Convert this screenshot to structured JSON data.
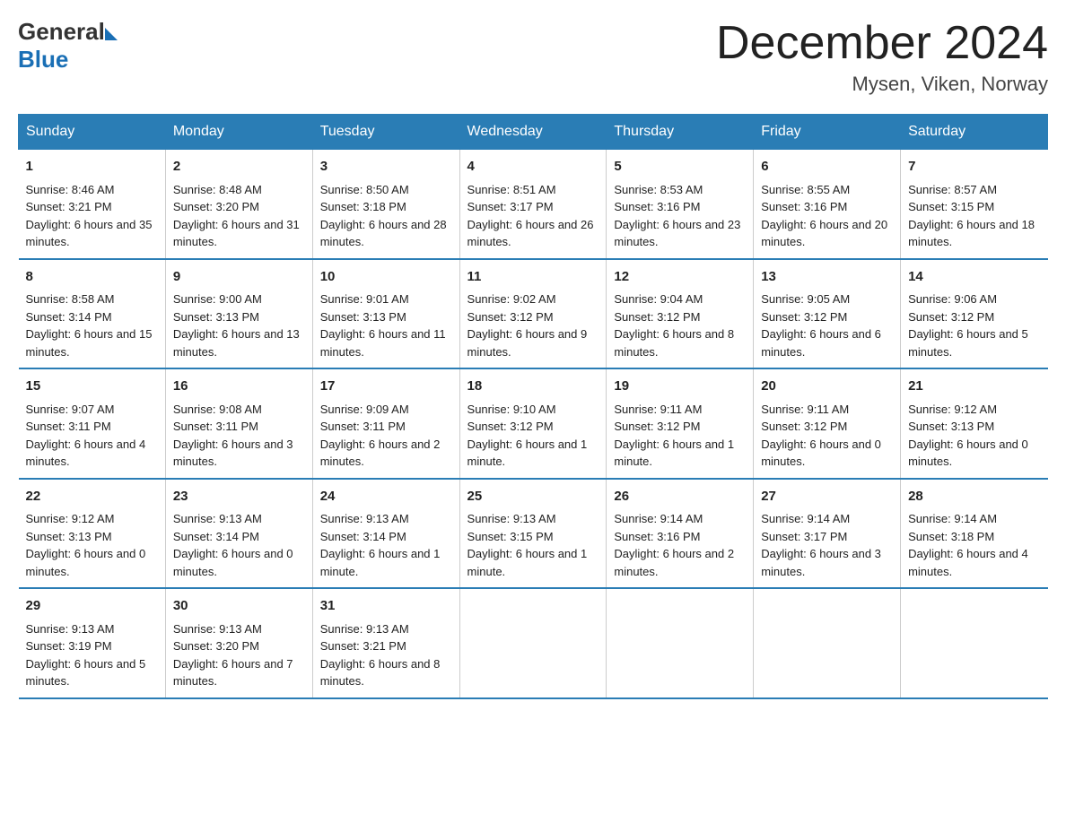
{
  "header": {
    "logo_general": "General",
    "logo_blue": "Blue",
    "month_title": "December 2024",
    "location": "Mysen, Viken, Norway"
  },
  "days_of_week": [
    "Sunday",
    "Monday",
    "Tuesday",
    "Wednesday",
    "Thursday",
    "Friday",
    "Saturday"
  ],
  "weeks": [
    [
      {
        "day": "1",
        "sunrise": "8:46 AM",
        "sunset": "3:21 PM",
        "daylight": "6 hours and 35 minutes."
      },
      {
        "day": "2",
        "sunrise": "8:48 AM",
        "sunset": "3:20 PM",
        "daylight": "6 hours and 31 minutes."
      },
      {
        "day": "3",
        "sunrise": "8:50 AM",
        "sunset": "3:18 PM",
        "daylight": "6 hours and 28 minutes."
      },
      {
        "day": "4",
        "sunrise": "8:51 AM",
        "sunset": "3:17 PM",
        "daylight": "6 hours and 26 minutes."
      },
      {
        "day": "5",
        "sunrise": "8:53 AM",
        "sunset": "3:16 PM",
        "daylight": "6 hours and 23 minutes."
      },
      {
        "day": "6",
        "sunrise": "8:55 AM",
        "sunset": "3:16 PM",
        "daylight": "6 hours and 20 minutes."
      },
      {
        "day": "7",
        "sunrise": "8:57 AM",
        "sunset": "3:15 PM",
        "daylight": "6 hours and 18 minutes."
      }
    ],
    [
      {
        "day": "8",
        "sunrise": "8:58 AM",
        "sunset": "3:14 PM",
        "daylight": "6 hours and 15 minutes."
      },
      {
        "day": "9",
        "sunrise": "9:00 AM",
        "sunset": "3:13 PM",
        "daylight": "6 hours and 13 minutes."
      },
      {
        "day": "10",
        "sunrise": "9:01 AM",
        "sunset": "3:13 PM",
        "daylight": "6 hours and 11 minutes."
      },
      {
        "day": "11",
        "sunrise": "9:02 AM",
        "sunset": "3:12 PM",
        "daylight": "6 hours and 9 minutes."
      },
      {
        "day": "12",
        "sunrise": "9:04 AM",
        "sunset": "3:12 PM",
        "daylight": "6 hours and 8 minutes."
      },
      {
        "day": "13",
        "sunrise": "9:05 AM",
        "sunset": "3:12 PM",
        "daylight": "6 hours and 6 minutes."
      },
      {
        "day": "14",
        "sunrise": "9:06 AM",
        "sunset": "3:12 PM",
        "daylight": "6 hours and 5 minutes."
      }
    ],
    [
      {
        "day": "15",
        "sunrise": "9:07 AM",
        "sunset": "3:11 PM",
        "daylight": "6 hours and 4 minutes."
      },
      {
        "day": "16",
        "sunrise": "9:08 AM",
        "sunset": "3:11 PM",
        "daylight": "6 hours and 3 minutes."
      },
      {
        "day": "17",
        "sunrise": "9:09 AM",
        "sunset": "3:11 PM",
        "daylight": "6 hours and 2 minutes."
      },
      {
        "day": "18",
        "sunrise": "9:10 AM",
        "sunset": "3:12 PM",
        "daylight": "6 hours and 1 minute."
      },
      {
        "day": "19",
        "sunrise": "9:11 AM",
        "sunset": "3:12 PM",
        "daylight": "6 hours and 1 minute."
      },
      {
        "day": "20",
        "sunrise": "9:11 AM",
        "sunset": "3:12 PM",
        "daylight": "6 hours and 0 minutes."
      },
      {
        "day": "21",
        "sunrise": "9:12 AM",
        "sunset": "3:13 PM",
        "daylight": "6 hours and 0 minutes."
      }
    ],
    [
      {
        "day": "22",
        "sunrise": "9:12 AM",
        "sunset": "3:13 PM",
        "daylight": "6 hours and 0 minutes."
      },
      {
        "day": "23",
        "sunrise": "9:13 AM",
        "sunset": "3:14 PM",
        "daylight": "6 hours and 0 minutes."
      },
      {
        "day": "24",
        "sunrise": "9:13 AM",
        "sunset": "3:14 PM",
        "daylight": "6 hours and 1 minute."
      },
      {
        "day": "25",
        "sunrise": "9:13 AM",
        "sunset": "3:15 PM",
        "daylight": "6 hours and 1 minute."
      },
      {
        "day": "26",
        "sunrise": "9:14 AM",
        "sunset": "3:16 PM",
        "daylight": "6 hours and 2 minutes."
      },
      {
        "day": "27",
        "sunrise": "9:14 AM",
        "sunset": "3:17 PM",
        "daylight": "6 hours and 3 minutes."
      },
      {
        "day": "28",
        "sunrise": "9:14 AM",
        "sunset": "3:18 PM",
        "daylight": "6 hours and 4 minutes."
      }
    ],
    [
      {
        "day": "29",
        "sunrise": "9:13 AM",
        "sunset": "3:19 PM",
        "daylight": "6 hours and 5 minutes."
      },
      {
        "day": "30",
        "sunrise": "9:13 AM",
        "sunset": "3:20 PM",
        "daylight": "6 hours and 7 minutes."
      },
      {
        "day": "31",
        "sunrise": "9:13 AM",
        "sunset": "3:21 PM",
        "daylight": "6 hours and 8 minutes."
      },
      null,
      null,
      null,
      null
    ]
  ]
}
